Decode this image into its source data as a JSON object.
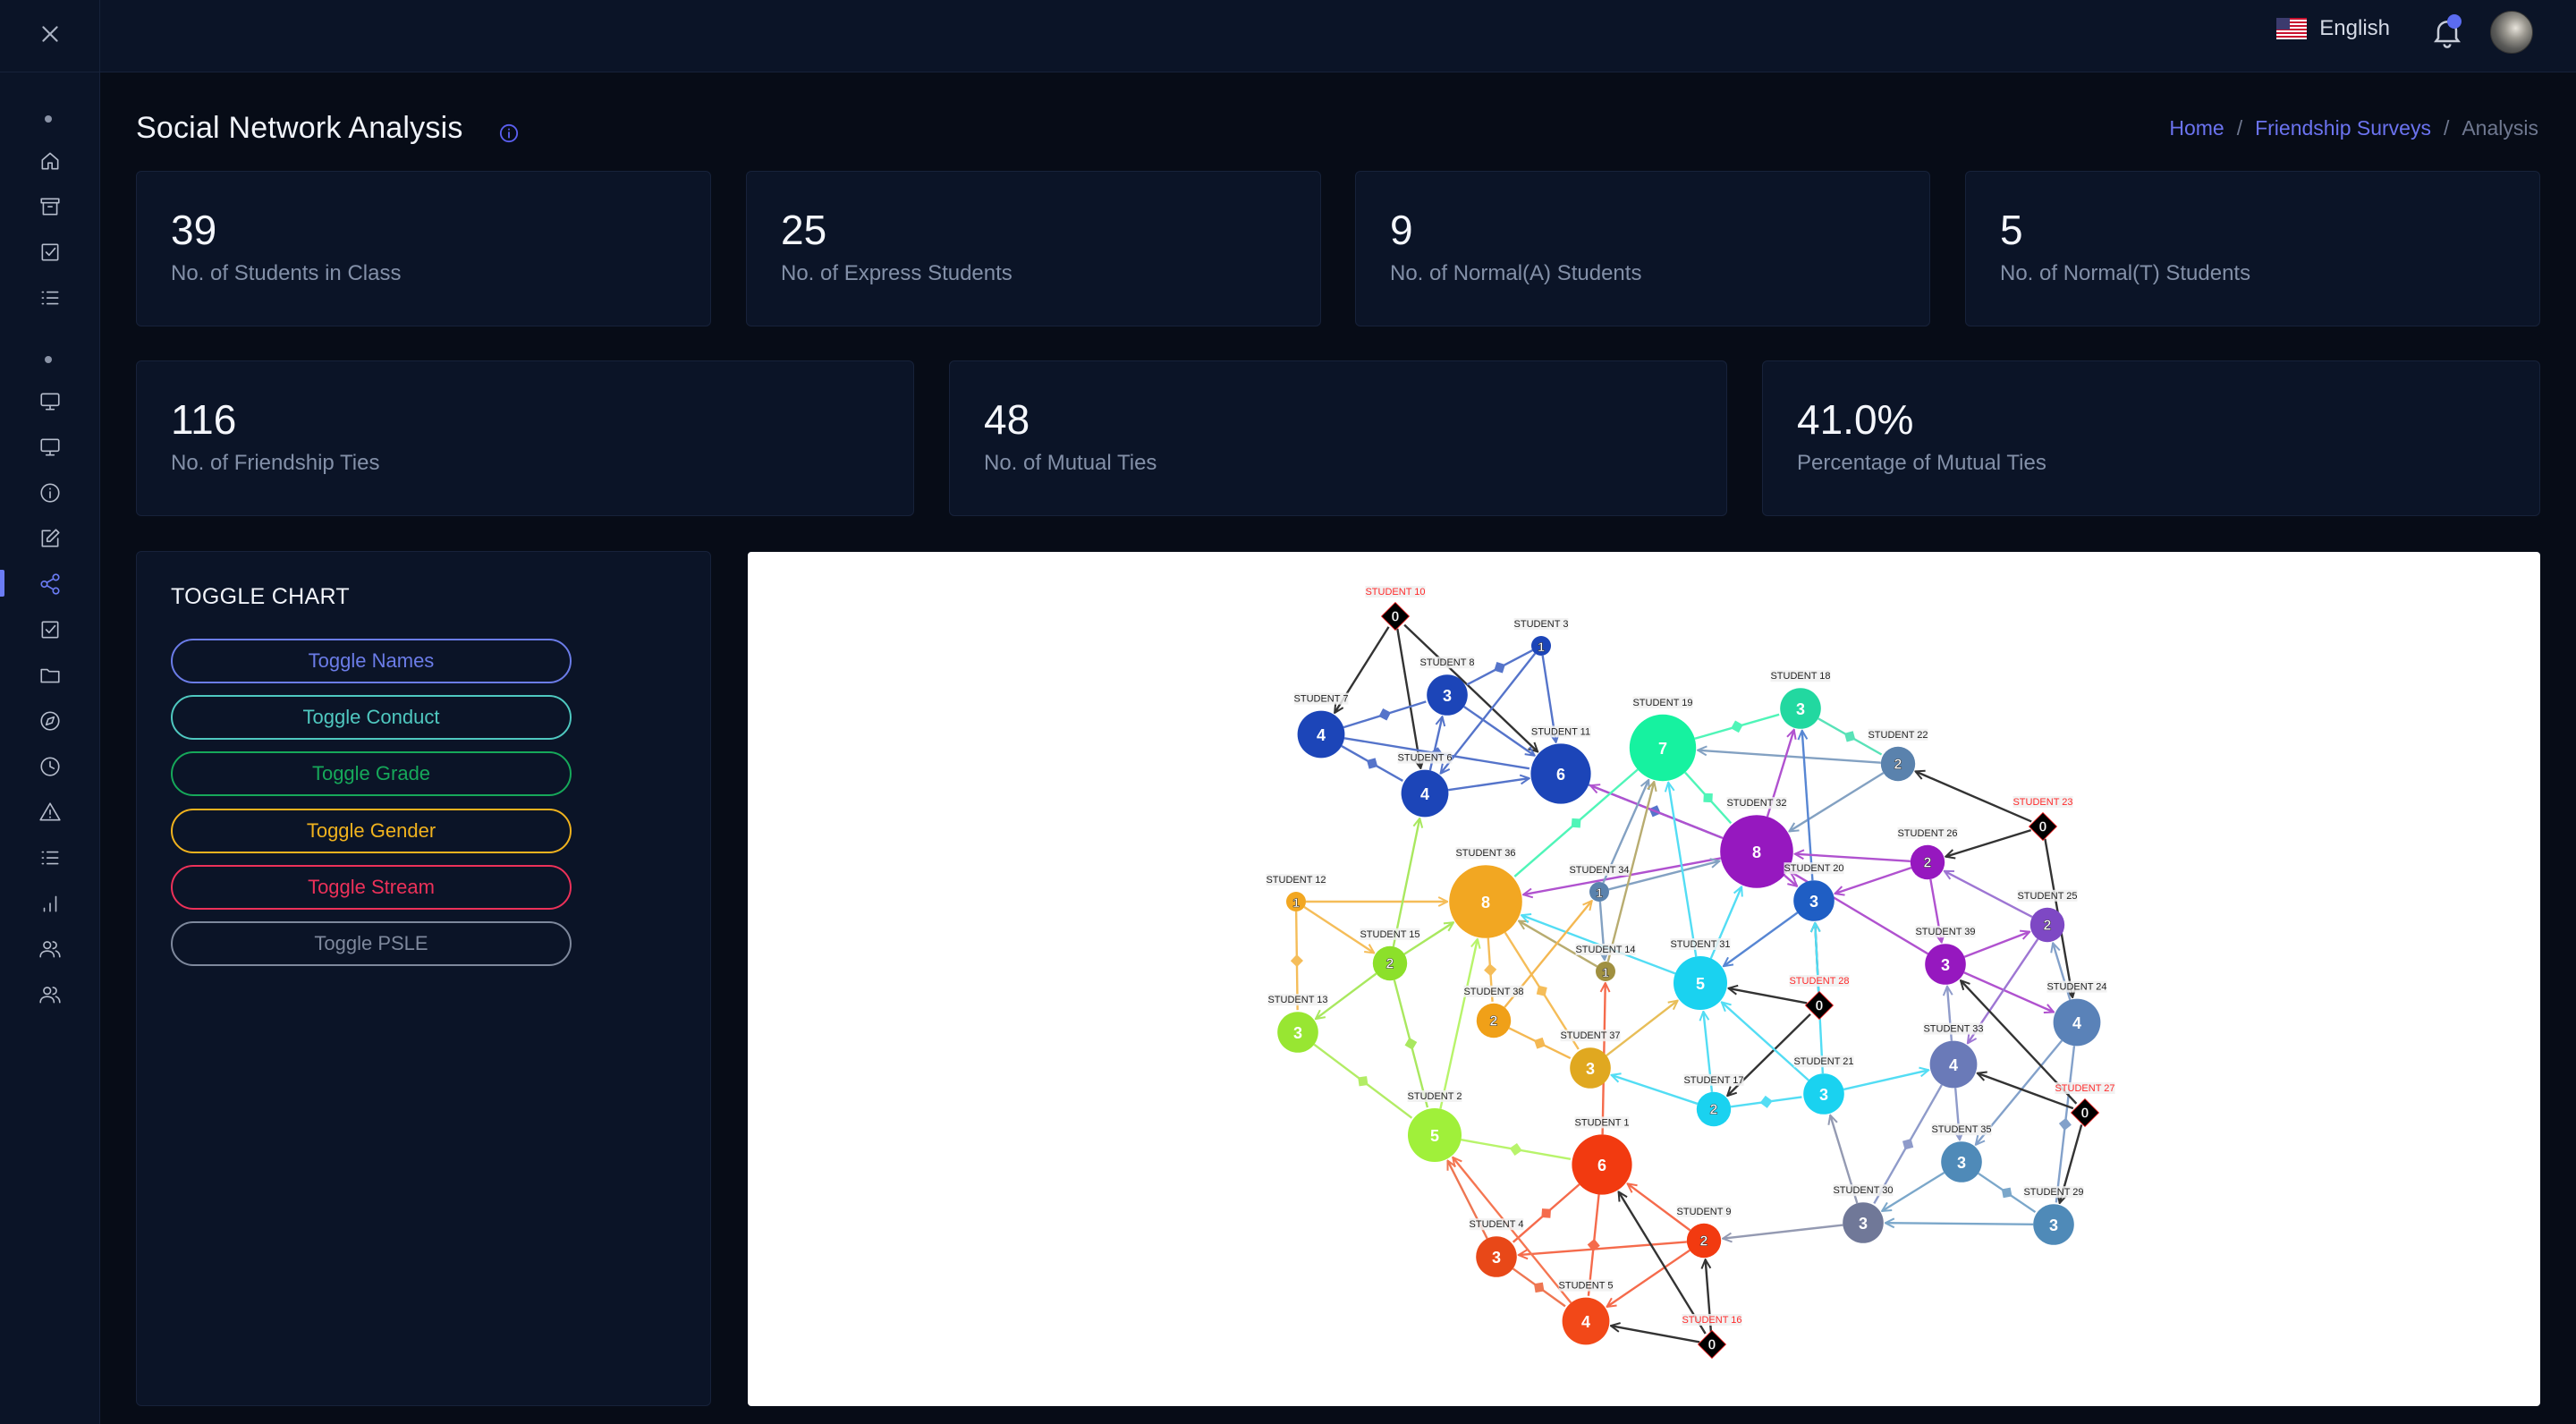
{
  "header": {
    "language": "English",
    "notification_count_visible": true
  },
  "page": {
    "title": "Social Network Analysis",
    "breadcrumb": [
      "Home",
      "Friendship Surveys",
      "Analysis"
    ]
  },
  "sidebar": {
    "items": [
      {
        "icon": "home-icon"
      },
      {
        "icon": "archive-icon"
      },
      {
        "icon": "checkbox-icon"
      },
      {
        "icon": "list-icon"
      },
      {
        "icon": "monitor-icon"
      },
      {
        "icon": "monitor-icon"
      },
      {
        "icon": "info-icon"
      },
      {
        "icon": "edit-icon"
      },
      {
        "icon": "share-network-icon",
        "active": true
      },
      {
        "icon": "checkbox-icon"
      },
      {
        "icon": "folder-icon"
      },
      {
        "icon": "compass-icon"
      },
      {
        "icon": "clock-icon"
      },
      {
        "icon": "warning-icon"
      },
      {
        "icon": "list-icon"
      },
      {
        "icon": "bar-chart-icon"
      },
      {
        "icon": "users-icon"
      },
      {
        "icon": "users-icon"
      }
    ]
  },
  "stats_row1": [
    {
      "value": "39",
      "label": "No. of Students in Class"
    },
    {
      "value": "25",
      "label": "No. of Express Students"
    },
    {
      "value": "9",
      "label": "No. of Normal(A) Students"
    },
    {
      "value": "5",
      "label": "No. of Normal(T) Students"
    }
  ],
  "stats_row2": [
    {
      "value": "116",
      "label": "No. of Friendship Ties"
    },
    {
      "value": "48",
      "label": "No. of Mutual Ties"
    },
    {
      "value": "41.0%",
      "label": "Percentage of Mutual Ties"
    }
  ],
  "toggle": {
    "title": "TOGGLE CHART",
    "buttons": [
      {
        "label": "Toggle Names",
        "color": "#6b7ce8"
      },
      {
        "label": "Toggle Conduct",
        "color": "#4fc8c0"
      },
      {
        "label": "Toggle Grade",
        "color": "#16a85a"
      },
      {
        "label": "Toggle Gender",
        "color": "#f0b21e"
      },
      {
        "label": "Toggle Stream",
        "color": "#ec3159"
      },
      {
        "label": "Toggle PSLE",
        "color": "#7e889c"
      }
    ]
  },
  "chart_data": {
    "type": "network",
    "title": "",
    "nodes": [
      {
        "id": "S10",
        "label": "STUDENT 10",
        "value": 0,
        "isolate": true,
        "color": "#000000"
      },
      {
        "id": "S3",
        "label": "STUDENT 3",
        "value": 1,
        "color": "#1c45b8"
      },
      {
        "id": "S8",
        "label": "STUDENT 8",
        "value": 3,
        "color": "#1c45b8"
      },
      {
        "id": "S7",
        "label": "STUDENT 7",
        "value": 4,
        "color": "#1c45b8"
      },
      {
        "id": "S6",
        "label": "STUDENT 6",
        "value": 4,
        "color": "#1c45b8"
      },
      {
        "id": "S11",
        "label": "STUDENT 11",
        "value": 6,
        "color": "#1c45b8"
      },
      {
        "id": "S19",
        "label": "STUDENT 19",
        "value": 7,
        "color": "#16f2a0"
      },
      {
        "id": "S18",
        "label": "STUDENT 18",
        "value": 3,
        "color": "#22d8a0"
      },
      {
        "id": "S22",
        "label": "STUDENT 22",
        "value": 2,
        "color": "#5a82ad"
      },
      {
        "id": "S23",
        "label": "STUDENT 23",
        "value": 0,
        "isolate": true,
        "color": "#000000"
      },
      {
        "id": "S32",
        "label": "STUDENT 32",
        "value": 8,
        "color": "#9618bf"
      },
      {
        "id": "S26",
        "label": "STUDENT 26",
        "value": 2,
        "color": "#9618bf"
      },
      {
        "id": "S20",
        "label": "STUDENT 20",
        "value": 3,
        "color": "#1f5ec4"
      },
      {
        "id": "S25",
        "label": "STUDENT 25",
        "value": 2,
        "color": "#7e48c4"
      },
      {
        "id": "S36",
        "label": "STUDENT 36",
        "value": 8,
        "color": "#f2a722"
      },
      {
        "id": "S12",
        "label": "STUDENT 12",
        "value": 1,
        "color": "#f2a722"
      },
      {
        "id": "S34",
        "label": "STUDENT 34",
        "value": 1,
        "color": "#5a82ad"
      },
      {
        "id": "S15",
        "label": "STUDENT 15",
        "value": 2,
        "color": "#8ce02a"
      },
      {
        "id": "S13",
        "label": "STUDENT 13",
        "value": 3,
        "color": "#98e632"
      },
      {
        "id": "S14",
        "label": "STUDENT 14",
        "value": 1,
        "color": "#a09040"
      },
      {
        "id": "S38",
        "label": "STUDENT 38",
        "value": 2,
        "color": "#f0a018"
      },
      {
        "id": "S31",
        "label": "STUDENT 31",
        "value": 5,
        "color": "#1ad2f0"
      },
      {
        "id": "S28",
        "label": "STUDENT 28",
        "value": 0,
        "isolate": true,
        "color": "#000000"
      },
      {
        "id": "S39",
        "label": "STUDENT 39",
        "value": 3,
        "color": "#9618bf"
      },
      {
        "id": "S24",
        "label": "STUDENT 24",
        "value": 4,
        "color": "#5a82b8"
      },
      {
        "id": "S37",
        "label": "STUDENT 37",
        "value": 3,
        "color": "#e0a820"
      },
      {
        "id": "S33",
        "label": "STUDENT 33",
        "value": 4,
        "color": "#6a7ab8"
      },
      {
        "id": "S17",
        "label": "STUDENT 17",
        "value": 2,
        "color": "#1ad2f0"
      },
      {
        "id": "S21",
        "label": "STUDENT 21",
        "value": 3,
        "color": "#1ad2f0"
      },
      {
        "id": "S27",
        "label": "STUDENT 27",
        "value": 0,
        "isolate": true,
        "color": "#000000"
      },
      {
        "id": "S2",
        "label": "STUDENT 2",
        "value": 5,
        "color": "#a0f03a"
      },
      {
        "id": "S1",
        "label": "STUDENT 1",
        "value": 6,
        "color": "#f23a10"
      },
      {
        "id": "S35",
        "label": "STUDENT 35",
        "value": 3,
        "color": "#4f8ab8"
      },
      {
        "id": "S30",
        "label": "STUDENT 30",
        "value": 3,
        "color": "#707898"
      },
      {
        "id": "S29",
        "label": "STUDENT 29",
        "value": 3,
        "color": "#4f8ab8"
      },
      {
        "id": "S9",
        "label": "STUDENT 9",
        "value": 2,
        "color": "#f23a10"
      },
      {
        "id": "S4",
        "label": "STUDENT 4",
        "value": 3,
        "color": "#e84818"
      },
      {
        "id": "S5",
        "label": "STUDENT 5",
        "value": 4,
        "color": "#f24818"
      },
      {
        "id": "S16",
        "label": "STUDENT 16",
        "value": 0,
        "isolate": true,
        "color": "#000000"
      }
    ],
    "edges": [
      {
        "from": "S10",
        "to": "S7",
        "mutual": false
      },
      {
        "from": "S10",
        "to": "S6",
        "mutual": false
      },
      {
        "from": "S10",
        "to": "S11",
        "mutual": false
      },
      {
        "from": "S3",
        "to": "S8",
        "mutual": true
      },
      {
        "from": "S3",
        "to": "S6",
        "mutual": false
      },
      {
        "from": "S3",
        "to": "S11",
        "mutual": false
      },
      {
        "from": "S7",
        "to": "S8",
        "mutual": true
      },
      {
        "from": "S7",
        "to": "S6",
        "mutual": true
      },
      {
        "from": "S7",
        "to": "S11",
        "mutual": true
      },
      {
        "from": "S8",
        "to": "S11",
        "mutual": false
      },
      {
        "from": "S6",
        "to": "S8",
        "mutual": false
      },
      {
        "from": "S6",
        "to": "S11",
        "mutual": false
      },
      {
        "from": "S11",
        "to": "S32",
        "mutual": true
      },
      {
        "from": "S32",
        "to": "S11",
        "mutual": false
      },
      {
        "from": "S19",
        "to": "S18",
        "mutual": true
      },
      {
        "from": "S18",
        "to": "S22",
        "mutual": true
      },
      {
        "from": "S22",
        "to": "S19",
        "mutual": false
      },
      {
        "from": "S22",
        "to": "S32",
        "mutual": false
      },
      {
        "from": "S32",
        "to": "S18",
        "mutual": false
      },
      {
        "from": "S19",
        "to": "S32",
        "mutual": true
      },
      {
        "from": "S19",
        "to": "S36",
        "mutual": true
      },
      {
        "from": "S20",
        "to": "S18",
        "mutual": false
      },
      {
        "from": "S23",
        "to": "S22",
        "mutual": false
      },
      {
        "from": "S23",
        "to": "S26",
        "mutual": false
      },
      {
        "from": "S23",
        "to": "S24",
        "mutual": false
      },
      {
        "from": "S26",
        "to": "S32",
        "mutual": false
      },
      {
        "from": "S26",
        "to": "S20",
        "mutual": false
      },
      {
        "from": "S26",
        "to": "S39",
        "mutual": false
      },
      {
        "from": "S25",
        "to": "S26",
        "mutual": false
      },
      {
        "from": "S39",
        "to": "S25",
        "mutual": false
      },
      {
        "from": "S39",
        "to": "S24",
        "mutual": false
      },
      {
        "from": "S39",
        "to": "S32",
        "mutual": false
      },
      {
        "from": "S25",
        "to": "S33",
        "mutual": false
      },
      {
        "from": "S24",
        "to": "S25",
        "mutual": false
      },
      {
        "from": "S32",
        "to": "S20",
        "mutual": false
      },
      {
        "from": "S32",
        "to": "S36",
        "mutual": false
      },
      {
        "from": "S34",
        "to": "S32",
        "mutual": false
      },
      {
        "from": "S34",
        "to": "S19",
        "mutual": false
      },
      {
        "from": "S34",
        "to": "S14",
        "mutual": false
      },
      {
        "from": "S14",
        "to": "S19",
        "mutual": false
      },
      {
        "from": "S14",
        "to": "S36",
        "mutual": false
      },
      {
        "from": "S1",
        "to": "S14",
        "mutual": false
      },
      {
        "from": "S31",
        "to": "S19",
        "mutual": false
      },
      {
        "from": "S31",
        "to": "S32",
        "mutual": false
      },
      {
        "from": "S31",
        "to": "S36",
        "mutual": false
      },
      {
        "from": "S20",
        "to": "S31",
        "mutual": false
      },
      {
        "from": "S28",
        "to": "S31",
        "mutual": false
      },
      {
        "from": "S28",
        "to": "S20",
        "mutual": false
      },
      {
        "from": "S28",
        "to": "S17",
        "mutual": false
      },
      {
        "from": "S21",
        "to": "S20",
        "mutual": false
      },
      {
        "from": "S21",
        "to": "S31",
        "mutual": false
      },
      {
        "from": "S17",
        "to": "S31",
        "mutual": false
      },
      {
        "from": "S17",
        "to": "S21",
        "mutual": true
      },
      {
        "from": "S17",
        "to": "S37",
        "mutual": false
      },
      {
        "from": "S21",
        "to": "S33",
        "mutual": false
      },
      {
        "from": "S30",
        "to": "S21",
        "mutual": false
      },
      {
        "from": "S12",
        "to": "S36",
        "mutual": false
      },
      {
        "from": "S12",
        "to": "S15",
        "mutual": false
      },
      {
        "from": "S12",
        "to": "S13",
        "mutual": true
      },
      {
        "from": "S15",
        "to": "S36",
        "mutual": false
      },
      {
        "from": "S15",
        "to": "S13",
        "mutual": false
      },
      {
        "from": "S15",
        "to": "S6",
        "mutual": false
      },
      {
        "from": "S15",
        "to": "S2",
        "mutual": true
      },
      {
        "from": "S13",
        "to": "S2",
        "mutual": true
      },
      {
        "from": "S2",
        "to": "S36",
        "mutual": false
      },
      {
        "from": "S36",
        "to": "S38",
        "mutual": true
      },
      {
        "from": "S36",
        "to": "S37",
        "mutual": true
      },
      {
        "from": "S38",
        "to": "S34",
        "mutual": false
      },
      {
        "from": "S38",
        "to": "S37",
        "mutual": true
      },
      {
        "from": "S37",
        "to": "S31",
        "mutual": false
      },
      {
        "from": "S2",
        "to": "S1",
        "mutual": true
      },
      {
        "from": "S1",
        "to": "S4",
        "mutual": true
      },
      {
        "from": "S1",
        "to": "S5",
        "mutual": true
      },
      {
        "from": "S9",
        "to": "S1",
        "mutual": false
      },
      {
        "from": "S9",
        "to": "S4",
        "mutual": false
      },
      {
        "from": "S9",
        "to": "S5",
        "mutual": false
      },
      {
        "from": "S4",
        "to": "S2",
        "mutual": false
      },
      {
        "from": "S5",
        "to": "S2",
        "mutual": false
      },
      {
        "from": "S4",
        "to": "S5",
        "mutual": true
      },
      {
        "from": "S16",
        "to": "S5",
        "mutual": false
      },
      {
        "from": "S16",
        "to": "S1",
        "mutual": false
      },
      {
        "from": "S16",
        "to": "S9",
        "mutual": false
      },
      {
        "from": "S30",
        "to": "S9",
        "mutual": false
      },
      {
        "from": "S33",
        "to": "S39",
        "mutual": false
      },
      {
        "from": "S33",
        "to": "S30",
        "mutual": true
      },
      {
        "from": "S33",
        "to": "S35",
        "mutual": false
      },
      {
        "from": "S24",
        "to": "S35",
        "mutual": false
      },
      {
        "from": "S24",
        "to": "S29",
        "mutual": true
      },
      {
        "from": "S27",
        "to": "S33",
        "mutual": false
      },
      {
        "from": "S27",
        "to": "S39",
        "mutual": false
      },
      {
        "from": "S27",
        "to": "S29",
        "mutual": false
      },
      {
        "from": "S35",
        "to": "S30",
        "mutual": false
      },
      {
        "from": "S35",
        "to": "S29",
        "mutual": true
      },
      {
        "from": "S29",
        "to": "S30",
        "mutual": false
      }
    ]
  }
}
